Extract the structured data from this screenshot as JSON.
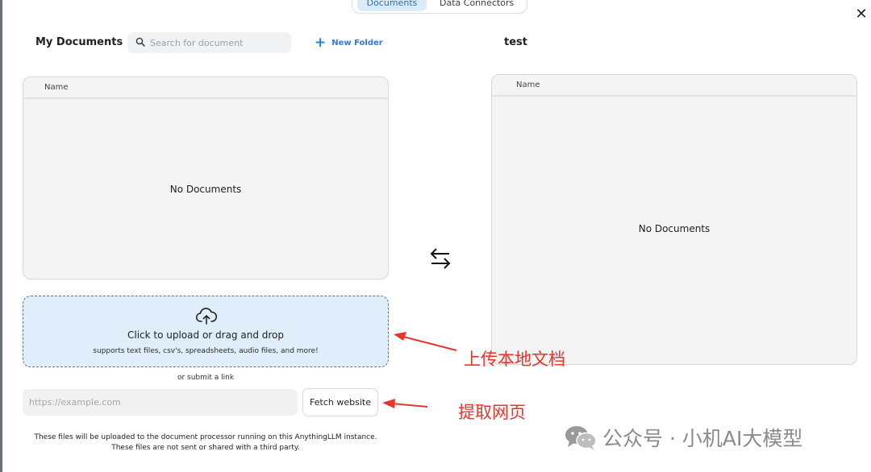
{
  "tabs": {
    "documents": "Documents",
    "connectors": "Data Connectors"
  },
  "my_documents": {
    "title": "My Documents",
    "search_placeholder": "Search for document",
    "new_folder_label": "New Folder",
    "column_name": "Name",
    "empty_text": "No Documents"
  },
  "workspace": {
    "title": "test",
    "column_name": "Name",
    "empty_text": "No Documents"
  },
  "upload": {
    "main_text": "Click to upload or drag and drop",
    "sub_text": "supports text files, csv's, spreadsheets, audio files, and more!"
  },
  "link": {
    "or_text": "or submit a link",
    "url_placeholder": "https://example.com",
    "fetch_label": "Fetch website"
  },
  "footnote": {
    "line1": "These files will be uploaded to the document processor running on this AnythingLLM instance.",
    "line2": "These files are not sent or shared with a third party."
  },
  "annotations": {
    "upload_note": "上传本地文档",
    "fetch_note": "提取网页",
    "color": "#e8352b"
  },
  "watermark": {
    "text": "公众号 · 小机AI大模型"
  },
  "icons": {
    "close": "close-icon",
    "search": "search-icon",
    "new_folder": "plus-icon",
    "swap": "swap-arrows-icon",
    "upload": "cloud-upload-icon",
    "wechat": "wechat-logo"
  },
  "colors": {
    "accent": "#2e7cd6",
    "dropzone_bg": "#dfeefa",
    "tab_active_bg": "#dcebf8"
  }
}
